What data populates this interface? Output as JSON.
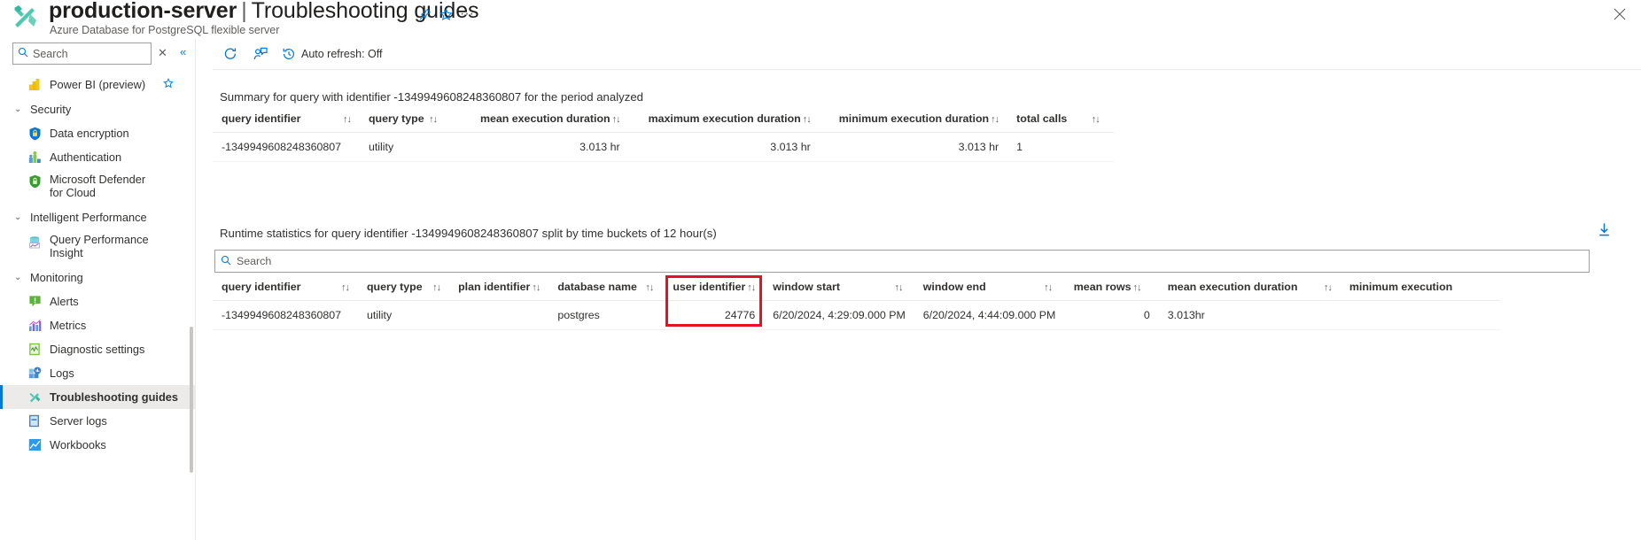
{
  "header": {
    "resource_name": "production-server",
    "separator": "|",
    "page_name": "Troubleshooting guides",
    "subtitle": "Azure Database for PostgreSQL flexible server",
    "resource_icon": "troubleshooting-guides-icon",
    "pin_icon": "pin-icon",
    "favorite_icon": "star-icon",
    "more_icon": "ellipsis-icon",
    "close_icon": "close-icon"
  },
  "sidebar": {
    "search": {
      "placeholder": "Search",
      "value": ""
    },
    "clear_icon": "close-icon",
    "collapse_icon": "double-chevron-left-icon",
    "items": [
      {
        "label": "Power BI (preview)",
        "icon": "power-bi-icon",
        "type": "item",
        "favorite": true,
        "selected": false
      },
      {
        "label": "Security",
        "icon": "chevron-down-icon",
        "type": "group"
      },
      {
        "label": "Data encryption",
        "icon": "lock-shield-icon",
        "type": "item",
        "selected": false
      },
      {
        "label": "Authentication",
        "icon": "authentication-icon",
        "type": "item",
        "selected": false
      },
      {
        "label": "Microsoft Defender for Cloud",
        "icon": "defender-shield-icon",
        "type": "item",
        "selected": false
      },
      {
        "label": "Intelligent Performance",
        "icon": "chevron-down-icon",
        "type": "group"
      },
      {
        "label": "Query Performance Insight",
        "icon": "query-performance-insight-icon",
        "type": "item",
        "selected": false
      },
      {
        "label": "Monitoring",
        "icon": "chevron-down-icon",
        "type": "group"
      },
      {
        "label": "Alerts",
        "icon": "alerts-icon",
        "type": "item",
        "selected": false
      },
      {
        "label": "Metrics",
        "icon": "metrics-icon",
        "type": "item",
        "selected": false
      },
      {
        "label": "Diagnostic settings",
        "icon": "diagnostic-settings-icon",
        "type": "item",
        "selected": false
      },
      {
        "label": "Logs",
        "icon": "logs-icon",
        "type": "item",
        "selected": false
      },
      {
        "label": "Troubleshooting guides",
        "icon": "troubleshooting-guides-icon",
        "type": "item",
        "selected": true
      },
      {
        "label": "Server logs",
        "icon": "server-logs-icon",
        "type": "item",
        "selected": false
      },
      {
        "label": "Workbooks",
        "icon": "workbooks-icon",
        "type": "item",
        "selected": false
      }
    ]
  },
  "command_bar": {
    "refresh": {
      "label": "",
      "icon": "refresh-icon"
    },
    "feedback": {
      "label": "",
      "icon": "feedback-person-icon"
    },
    "auto_refresh": {
      "label": "Auto refresh: Off",
      "icon": "clock-history-icon"
    }
  },
  "summary_section": {
    "title": "Summary for query with identifier -1349949608248360807 for the period analyzed",
    "columns": [
      {
        "label": "query identifier",
        "sortable": true,
        "align": "left"
      },
      {
        "label": "query type",
        "sortable": true,
        "align": "left"
      },
      {
        "label": "mean execution duration",
        "sortable": true,
        "align": "left"
      },
      {
        "label": "maximum execution duration",
        "sortable": true,
        "align": "left"
      },
      {
        "label": "minimum execution duration",
        "sortable": true,
        "align": "left"
      },
      {
        "label": "total calls",
        "sortable": true,
        "align": "left"
      }
    ],
    "rows": [
      {
        "query_identifier": "-1349949608248360807",
        "query_type": "utility",
        "mean_execution_duration": "3.013 hr",
        "maximum_execution_duration": "3.013 hr",
        "minimum_execution_duration": "3.013 hr",
        "total_calls": "1"
      }
    ]
  },
  "runtime_section": {
    "title": "Runtime statistics for query identifier -1349949608248360807 split by time buckets of 12 hour(s)",
    "download_icon": "download-icon",
    "search": {
      "placeholder": "Search",
      "value": ""
    },
    "columns": [
      {
        "label": "query identifier",
        "sortable": true
      },
      {
        "label": "query type",
        "sortable": true
      },
      {
        "label": "plan identifier",
        "sortable": true
      },
      {
        "label": "database name",
        "sortable": true
      },
      {
        "label": "user identifier",
        "sortable": true,
        "highlighted": true
      },
      {
        "label": "window start",
        "sortable": true
      },
      {
        "label": "window end",
        "sortable": true
      },
      {
        "label": "mean rows",
        "sortable": true
      },
      {
        "label": "mean execution duration",
        "sortable": true
      },
      {
        "label": "minimum execution",
        "sortable": false
      }
    ],
    "rows": [
      {
        "query_identifier": "-1349949608248360807",
        "query_type": "utility",
        "plan_identifier": "",
        "database_name": "postgres",
        "user_identifier": "24776",
        "window_start": "6/20/2024, 4:29:09.000 PM",
        "window_end": "6/20/2024, 4:44:09.000 PM",
        "mean_rows": "0",
        "mean_execution_duration": "3.013hr",
        "minimum_execution": ""
      }
    ]
  },
  "annotation": {
    "highlight_color": "#e81123",
    "highlight_target": "user identifier column"
  },
  "colors": {
    "accent": "#0078d4",
    "selected_nav_bg": "#edebe9",
    "text": "#323130",
    "muted_text": "#605e5c",
    "border": "#edebe9"
  }
}
